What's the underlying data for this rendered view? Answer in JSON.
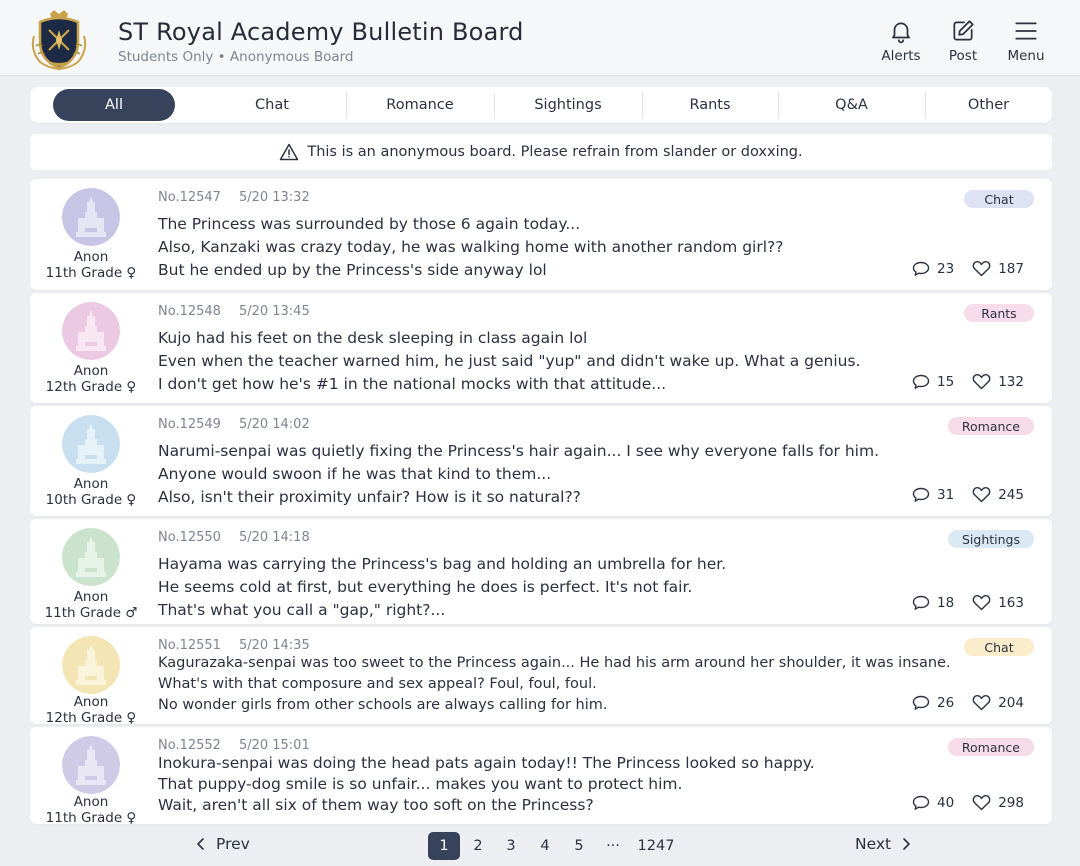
{
  "header": {
    "title": "ST Royal Academy Bulletin Board",
    "subtitle": "Students Only • Anonymous Board",
    "logo_icon": "academy-crest-icon",
    "actions": [
      {
        "label": "Alerts",
        "icon": "bell-icon"
      },
      {
        "label": "Post",
        "icon": "edit-icon"
      },
      {
        "label": "Menu",
        "icon": "hamburger-menu-icon"
      }
    ]
  },
  "tabs": [
    {
      "label": "All",
      "active": true
    },
    {
      "label": "Chat"
    },
    {
      "label": "Romance"
    },
    {
      "label": "Sightings"
    },
    {
      "label": "Rants"
    },
    {
      "label": "Q&A"
    },
    {
      "label": "Other"
    }
  ],
  "notice": {
    "icon": "warning-triangle-icon",
    "text": "This is an anonymous board. Please refrain from slander or doxxing."
  },
  "posts": [
    {
      "name": "Anon",
      "grade": "11th Grade ♀",
      "id": "No.12547",
      "time": "5/20 13:32",
      "lines": [
        "The Princess was surrounded by those 6 again today...",
        "Also, Kanzaki was crazy today, he was walking home with another random girl??",
        "But he ended up by the Princess's side anyway lol"
      ],
      "category": "Chat",
      "comments": "23",
      "likes": "187",
      "avatar_color": "#c7c5e6",
      "badge_color": "#dde3f4"
    },
    {
      "name": "Anon",
      "grade": "12th Grade ♀",
      "id": "No.12548",
      "time": "5/20 13:45",
      "lines": [
        "Kujo had his feet on the desk sleeping in class again lol",
        "Even when the teacher warned him, he just said \"yup\" and didn't wake up. What a genius.",
        "I don't get how he's #1 in the national mocks with that attitude..."
      ],
      "category": "Rants",
      "comments": "15",
      "likes": "132",
      "avatar_color": "#ebc9e2",
      "badge_color": "#f7dcec"
    },
    {
      "name": "Anon",
      "grade": "10th Grade ♀",
      "id": "No.12549",
      "time": "5/20 14:02",
      "lines": [
        "Narumi-senpai was quietly fixing the Princess's hair again... I see why everyone falls for him.",
        "Anyone would swoon if he was that kind to them...",
        "Also, isn't their proximity unfair? How is it so natural??"
      ],
      "category": "Romance",
      "comments": "31",
      "likes": "245",
      "avatar_color": "#c8dff0",
      "badge_color": "#f6dbe8"
    },
    {
      "name": "Anon",
      "grade": "11th Grade ♂",
      "id": "No.12550",
      "time": "5/20 14:18",
      "lines": [
        "Hayama was carrying the Princess's bag and holding an umbrella for her.",
        "He seems cold at first, but everything he does is perfect. It's not fair.",
        "That's what you call a \"gap,\" right?..."
      ],
      "category": "Sightings",
      "comments": "18",
      "likes": "163",
      "avatar_color": "#cbe3cc",
      "badge_color": "#dbe9f5"
    },
    {
      "name": "Anon",
      "grade": "12th Grade ♀",
      "id": "No.12551",
      "time": "5/20 14:35",
      "lines": [
        "Kagurazaka-senpai was too sweet to the Princess again... He had his arm around her shoulder, it was insane.",
        "What's with that composure and sex appeal? Foul, foul, foul.",
        "No wonder girls from other schools are always calling for him."
      ],
      "category": "Chat",
      "comments": "26",
      "likes": "204",
      "avatar_color": "#f3e6b4",
      "badge_color": "#fbeccb"
    },
    {
      "name": "Anon",
      "grade": "11th Grade ♀",
      "id": "No.12552",
      "time": "5/20 15:01",
      "lines": [
        "Inokura-senpai was doing the head pats again today!! The Princess looked so happy.",
        "That puppy-dog smile is so unfair... makes you want to protect him.",
        "Wait, aren't all six of them way too soft on the Princess?"
      ],
      "category": "Romance",
      "comments": "40",
      "likes": "298",
      "avatar_color": "#cfcbe6",
      "badge_color": "#f6dbe8"
    }
  ],
  "pagination": {
    "prev": "Prev",
    "next": "Next",
    "pages": [
      "1",
      "2",
      "3",
      "4",
      "5"
    ],
    "ellipsis": "···",
    "last": "1247",
    "current": "1"
  }
}
